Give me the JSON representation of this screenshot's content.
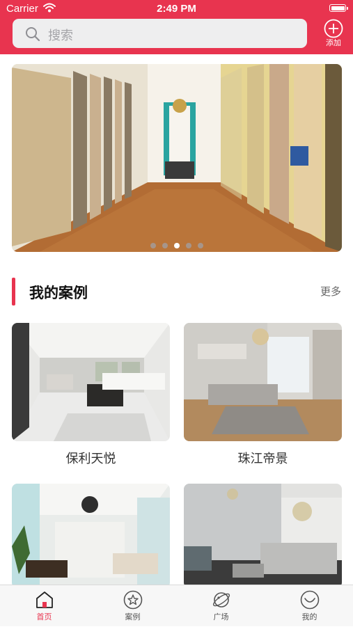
{
  "status_bar": {
    "carrier": "Carrier",
    "time": "2:49 PM"
  },
  "search": {
    "placeholder": "搜索"
  },
  "add_button": {
    "label": "添加"
  },
  "banner": {
    "slide_count": 5,
    "active_slide": 3
  },
  "section": {
    "title": "我的案例",
    "more": "更多"
  },
  "cases": [
    {
      "name": "保利天悦"
    },
    {
      "name": "珠江帝景"
    },
    {
      "name": ""
    },
    {
      "name": ""
    }
  ],
  "tabbar": {
    "items": [
      {
        "label": "首页",
        "icon": "home-icon"
      },
      {
        "label": "案例",
        "icon": "star-icon"
      },
      {
        "label": "广场",
        "icon": "planet-icon"
      },
      {
        "label": "我的",
        "icon": "smile-icon"
      }
    ],
    "active": 0
  },
  "colors": {
    "accent": "#e8344f"
  }
}
